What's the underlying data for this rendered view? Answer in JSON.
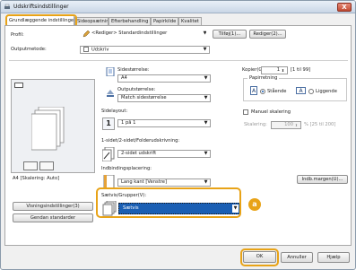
{
  "window": {
    "title": "Udskriftsindstillinger",
    "close_glyph": "X"
  },
  "tabs": [
    {
      "label": "Grundlæggende indstillinger",
      "active": true
    },
    {
      "label": "Sideopsætning"
    },
    {
      "label": "Efterbehandling"
    },
    {
      "label": "Papirkilde"
    },
    {
      "label": "Kvalitet"
    }
  ],
  "profile": {
    "label": "Profil:",
    "value": "<Rediger> Standardindstillinger",
    "add_button": "Tilføj(1)...",
    "edit_button": "Rediger(2)..."
  },
  "output_method": {
    "label": "Outputmetode:",
    "value": "Udskriv"
  },
  "page_size": {
    "label": "Sidestørrelse:",
    "value": "A4"
  },
  "output_size": {
    "label": "Outputstørrelse:",
    "value": "Match sidestørrelse"
  },
  "copies": {
    "label": "Kopier(G):",
    "value": "1",
    "range": "[1 til 99]"
  },
  "orientation": {
    "group_label": "Papirretning",
    "portrait_label": "Stående",
    "landscape_label": "Liggende",
    "portrait_glyph": "A",
    "landscape_glyph": "A",
    "selected": "Stående"
  },
  "page_layout": {
    "label": "Sidelayout:",
    "value": "1 på 1",
    "glyph": "1"
  },
  "manual_scaling": {
    "label": "Manuel skalering",
    "scaling_label": "Skalering:",
    "value": "100",
    "range": "% [25 til 200]"
  },
  "duplex": {
    "label": "1-sidet/2-sidet/Folderudskrivning:",
    "value": "2-sidet udskrift"
  },
  "binding": {
    "label": "Indbindingsplacering:",
    "value": "Lang kant [Venstre]",
    "margin_button": "Indb.margen(U)..."
  },
  "collate": {
    "label": "Sætvis/Grupper(V):",
    "value": "Sætvis"
  },
  "preview": {
    "status": "A4 [Skalering: Auto]"
  },
  "left_buttons": {
    "settings": "Visningsindstillinger(3)",
    "restore": "Gendan standarder"
  },
  "callout": {
    "letter": "a"
  },
  "footer": {
    "ok": "OK",
    "cancel": "Annuller",
    "help": "Hjælp"
  },
  "colors": {
    "accent_highlight": "#e8a317",
    "selection_blue": "#1a5fb4"
  }
}
